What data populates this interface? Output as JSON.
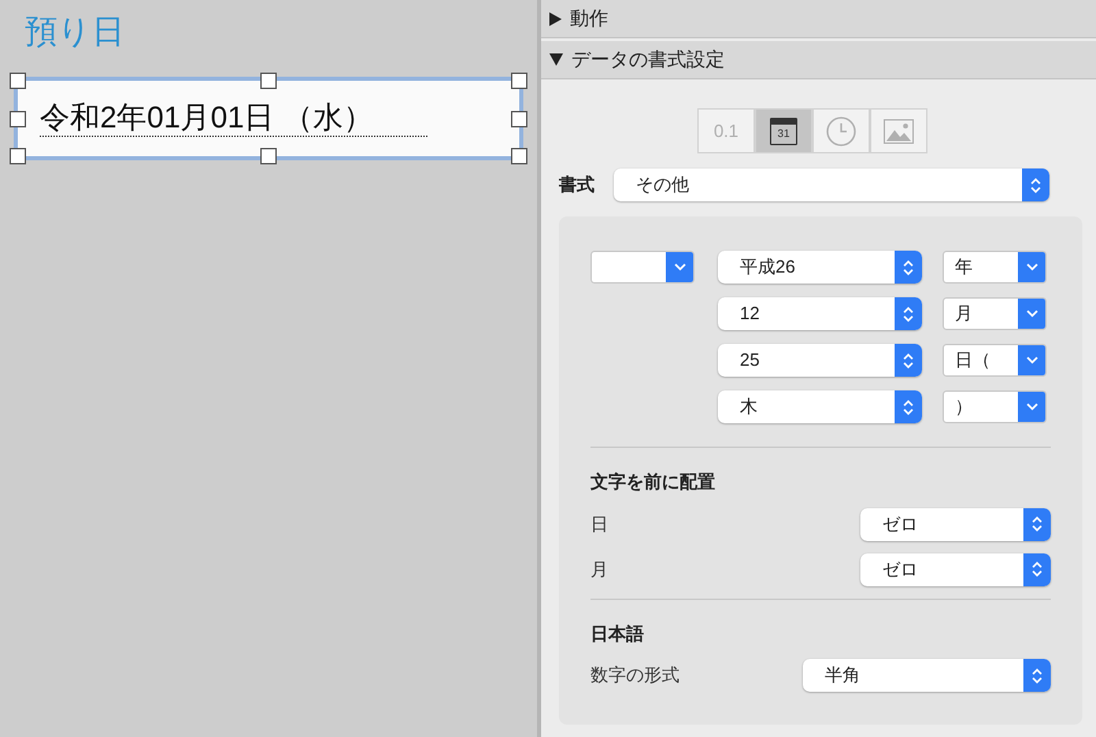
{
  "canvas": {
    "label": "預り日",
    "field": {
      "value": "令和2年01月01日 （水）",
      "selected": true
    }
  },
  "sections": [
    {
      "title": "動作",
      "expanded": false
    },
    {
      "title": "データの書式設定",
      "expanded": true
    }
  ],
  "format_types": [
    {
      "kind": "number",
      "label": "0.1",
      "selected": false
    },
    {
      "kind": "date",
      "label": "31",
      "selected": true
    },
    {
      "kind": "time",
      "selected": false
    },
    {
      "kind": "picture",
      "selected": false
    }
  ],
  "format": {
    "label": "書式",
    "value": "その他"
  },
  "date_parts": [
    {
      "has_prefix": true,
      "value": "平成26",
      "suffix": "年"
    },
    {
      "has_prefix": false,
      "value": "12",
      "suffix": "月"
    },
    {
      "has_prefix": false,
      "value": "25",
      "suffix": "日（"
    },
    {
      "has_prefix": false,
      "value": "木",
      "suffix": "）"
    }
  ],
  "leading": {
    "title": "文字を前に配置",
    "rows": [
      {
        "label": "日",
        "value": "ゼロ"
      },
      {
        "label": "月",
        "value": "ゼロ"
      }
    ]
  },
  "japanese": {
    "title": "日本語",
    "rows": [
      {
        "label": "数字の形式",
        "value": "半角"
      }
    ]
  }
}
